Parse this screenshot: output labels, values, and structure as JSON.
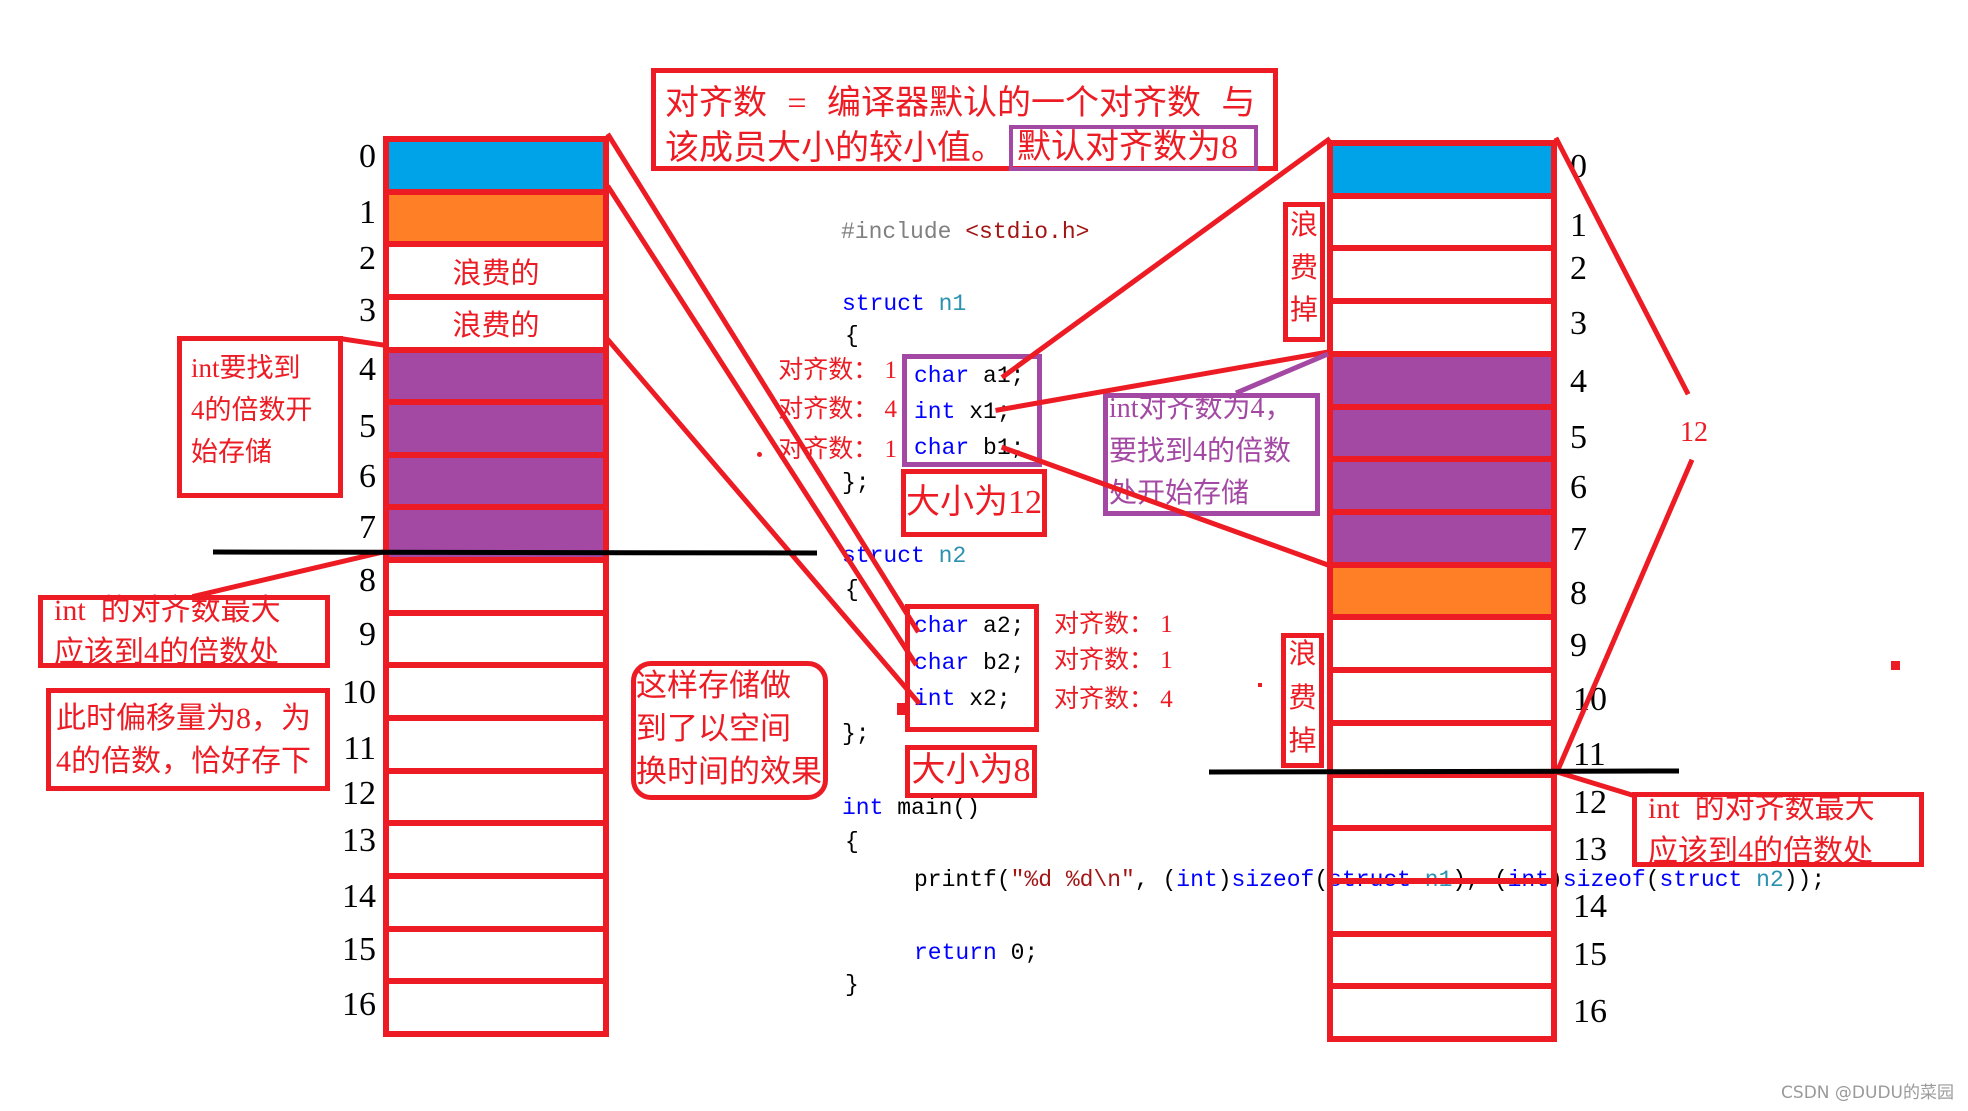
{
  "colors": {
    "red": "#ED1C24",
    "purple": "#A349A4",
    "blue": "#00A2E8",
    "orange": "#FF7F27",
    "black": "#000000",
    "watermark": "#9A9A9A"
  },
  "syntax_colors": {
    "keyword": "#0000FF",
    "type": "#2B91AF",
    "string": "#A31515",
    "preprocessor": "#808080",
    "plain": "#000000"
  },
  "note_top": {
    "line1": "对齐数 = 编译器默认的一个对齐数 与",
    "line2": "该成员大小的较小值。",
    "highlight": "默认对齐数为8"
  },
  "memory": {
    "left": {
      "cells": [
        {
          "offset": "0",
          "fill": "blue",
          "text": ""
        },
        {
          "offset": "1",
          "fill": "orange",
          "text": ""
        },
        {
          "offset": "2",
          "fill": "none",
          "text": "浪费的"
        },
        {
          "offset": "3",
          "fill": "none",
          "text": "浪费的"
        },
        {
          "offset": "4",
          "fill": "purple",
          "text": ""
        },
        {
          "offset": "5",
          "fill": "purple",
          "text": ""
        },
        {
          "offset": "6",
          "fill": "purple",
          "text": ""
        },
        {
          "offset": "7",
          "fill": "purple",
          "text": ""
        },
        {
          "offset": "8",
          "fill": "none",
          "text": ""
        },
        {
          "offset": "9",
          "fill": "none",
          "text": ""
        },
        {
          "offset": "10",
          "fill": "none",
          "text": ""
        },
        {
          "offset": "11",
          "fill": "none",
          "text": ""
        },
        {
          "offset": "12",
          "fill": "none",
          "text": ""
        },
        {
          "offset": "13",
          "fill": "none",
          "text": ""
        },
        {
          "offset": "14",
          "fill": "none",
          "text": ""
        },
        {
          "offset": "15",
          "fill": "none",
          "text": ""
        },
        {
          "offset": "16",
          "fill": "none",
          "text": ""
        }
      ]
    },
    "right": {
      "cells": [
        {
          "offset": "0",
          "fill": "blue",
          "text": ""
        },
        {
          "offset": "1",
          "fill": "none",
          "text": ""
        },
        {
          "offset": "2",
          "fill": "none",
          "text": ""
        },
        {
          "offset": "3",
          "fill": "none",
          "text": ""
        },
        {
          "offset": "4",
          "fill": "purple",
          "text": ""
        },
        {
          "offset": "5",
          "fill": "purple",
          "text": ""
        },
        {
          "offset": "6",
          "fill": "purple",
          "text": ""
        },
        {
          "offset": "7",
          "fill": "purple",
          "text": ""
        },
        {
          "offset": "8",
          "fill": "orange",
          "text": ""
        },
        {
          "offset": "9",
          "fill": "none",
          "text": ""
        },
        {
          "offset": "10",
          "fill": "none",
          "text": ""
        },
        {
          "offset": "11",
          "fill": "none",
          "text": ""
        },
        {
          "offset": "12",
          "fill": "none",
          "text": ""
        },
        {
          "offset": "13",
          "fill": "none",
          "text": ""
        },
        {
          "offset": "14",
          "fill": "none",
          "text": ""
        },
        {
          "offset": "15",
          "fill": "none",
          "text": ""
        },
        {
          "offset": "16",
          "fill": "none",
          "text": ""
        }
      ]
    },
    "brace_label": "12"
  },
  "annotations": {
    "left_int_find": [
      "int要找到",
      "4的倍数开",
      "始存储"
    ],
    "left_int_max": [
      "int  的对齐数最大",
      "应该到4的倍数处"
    ],
    "left_offset": [
      "此时偏移量为8，为",
      "4的倍数，恰好存下"
    ],
    "tradeoff": [
      "这样存储做",
      "到了以空间",
      "换时间的效果"
    ],
    "n1_align": [
      "对齐数： 1",
      "对齐数： 4",
      "对齐数： 1"
    ],
    "n1_size": "大小为12",
    "n2_align": [
      "对齐数： 1",
      "对齐数： 1",
      "对齐数： 4"
    ],
    "n2_size": "大小为8",
    "int_align_note": [
      "int对齐数为4，",
      "要找到4的倍数",
      "处开始存储"
    ],
    "waste_top": [
      "浪",
      "费",
      "掉"
    ],
    "waste_bottom": [
      "浪",
      "费",
      "掉"
    ],
    "right_int_max": [
      "int  的对齐数最大",
      "应该到4的倍数处"
    ]
  },
  "code": {
    "lines": [
      {
        "tokens": [
          {
            "text": "#include ",
            "kind": "preprocessor"
          },
          {
            "text": "<stdio.h>",
            "kind": "string"
          }
        ]
      },
      {
        "tokens": [
          {
            "text": "struct",
            "kind": "keyword"
          },
          {
            "text": " ",
            "kind": "plain"
          },
          {
            "text": "n1",
            "kind": "type"
          }
        ]
      },
      {
        "tokens": [
          {
            "text": "{",
            "kind": "plain"
          }
        ]
      },
      {
        "tokens": [
          {
            "text": "char",
            "kind": "keyword"
          },
          {
            "text": " a1;",
            "kind": "plain"
          }
        ]
      },
      {
        "tokens": [
          {
            "text": "int",
            "kind": "keyword"
          },
          {
            "text": " x1;",
            "kind": "plain"
          }
        ]
      },
      {
        "tokens": [
          {
            "text": "char",
            "kind": "keyword"
          },
          {
            "text": " b1;",
            "kind": "plain"
          }
        ]
      },
      {
        "tokens": [
          {
            "text": "};",
            "kind": "plain"
          }
        ]
      },
      {
        "tokens": [
          {
            "text": "struct",
            "kind": "keyword"
          },
          {
            "text": " ",
            "kind": "plain"
          },
          {
            "text": "n2",
            "kind": "type"
          }
        ]
      },
      {
        "tokens": [
          {
            "text": "{",
            "kind": "plain"
          }
        ]
      },
      {
        "tokens": [
          {
            "text": "char",
            "kind": "keyword"
          },
          {
            "text": " a2;",
            "kind": "plain"
          }
        ]
      },
      {
        "tokens": [
          {
            "text": "char",
            "kind": "keyword"
          },
          {
            "text": " b2;",
            "kind": "plain"
          }
        ]
      },
      {
        "tokens": [
          {
            "text": "int",
            "kind": "keyword"
          },
          {
            "text": " x2;",
            "kind": "plain"
          }
        ]
      },
      {
        "tokens": [
          {
            "text": "};",
            "kind": "plain"
          }
        ]
      },
      {
        "tokens": [
          {
            "text": "int",
            "kind": "keyword"
          },
          {
            "text": " main()",
            "kind": "plain"
          }
        ]
      },
      {
        "tokens": [
          {
            "text": "{",
            "kind": "plain"
          }
        ]
      },
      {
        "tokens": [
          {
            "text": "printf(",
            "kind": "plain"
          },
          {
            "text": "\"%d %d\\n\"",
            "kind": "string"
          },
          {
            "text": ", (",
            "kind": "plain"
          },
          {
            "text": "int",
            "kind": "keyword"
          },
          {
            "text": ")",
            "kind": "plain"
          },
          {
            "text": "sizeof",
            "kind": "keyword"
          },
          {
            "text": "(",
            "kind": "plain"
          },
          {
            "text": "struct",
            "kind": "keyword"
          },
          {
            "text": " ",
            "kind": "plain"
          },
          {
            "text": "n1",
            "kind": "type"
          },
          {
            "text": "), (",
            "kind": "plain"
          },
          {
            "text": "int",
            "kind": "keyword"
          },
          {
            "text": ")",
            "kind": "plain"
          },
          {
            "text": "sizeof",
            "kind": "keyword"
          },
          {
            "text": "(",
            "kind": "plain"
          },
          {
            "text": "struct",
            "kind": "keyword"
          },
          {
            "text": " ",
            "kind": "plain"
          },
          {
            "text": "n2",
            "kind": "type"
          },
          {
            "text": "));",
            "kind": "plain"
          }
        ]
      },
      {
        "tokens": [
          {
            "text": "return",
            "kind": "keyword"
          },
          {
            "text": " 0;",
            "kind": "plain"
          }
        ]
      },
      {
        "tokens": [
          {
            "text": "}",
            "kind": "plain"
          }
        ]
      }
    ]
  },
  "watermark": "CSDN @DUDU的菜园"
}
